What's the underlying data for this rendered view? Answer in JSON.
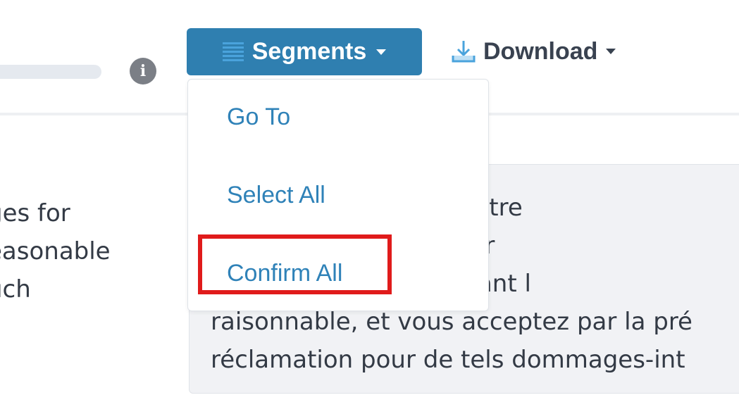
{
  "toolbar": {
    "info_icon_glyph": "i",
    "segments_label": "Segments",
    "download_label": "Download"
  },
  "dropdown": {
    "items": [
      {
        "label": "Go To"
      },
      {
        "label": "Select All"
      },
      {
        "label": "Confirm All"
      }
    ],
    "highlighted_item": "Confirm All"
  },
  "source_text": {
    "lines": [
      "ges for",
      "easonable",
      "uch"
    ]
  },
  "target_text": {
    "lines": [
      "et vous acceptez en outre",
      "intérêts en guise de cor",
      "ous aurez gagné pendant l",
      "raisonnable, et vous acceptez par la pré",
      "réclamation pour de tels dommages-int"
    ]
  },
  "colors": {
    "segments_button_bg": "#2f7fb0",
    "menu_link": "#2f82b8",
    "highlight_border": "#e01b1b",
    "download_icon": "#4aa3dc"
  }
}
